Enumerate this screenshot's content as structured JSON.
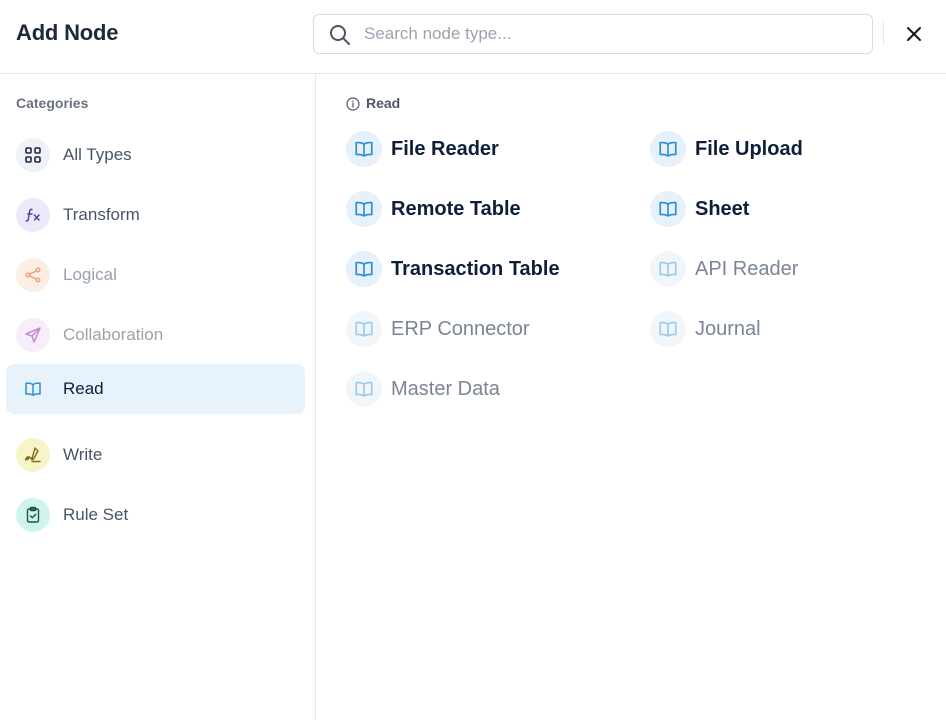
{
  "header": {
    "title": "Add Node",
    "search_placeholder": "Search node type...",
    "search_value": ""
  },
  "sidebar": {
    "heading": "Categories",
    "items": [
      {
        "label": "All Types",
        "icon": "grid-icon",
        "state": "normal"
      },
      {
        "label": "Transform",
        "icon": "function-icon",
        "state": "normal"
      },
      {
        "label": "Logical",
        "icon": "share-branch-icon",
        "state": "disabled"
      },
      {
        "label": "Collaboration",
        "icon": "send-icon",
        "state": "disabled"
      },
      {
        "label": "Read",
        "icon": "book-icon",
        "state": "active"
      },
      {
        "label": "Write",
        "icon": "signature-pen-icon",
        "state": "normal"
      },
      {
        "label": "Rule Set",
        "icon": "clipboard-check-icon",
        "state": "normal"
      }
    ]
  },
  "main": {
    "heading": "Read",
    "nodes": [
      {
        "label": "File Reader",
        "enabled": true
      },
      {
        "label": "File Upload",
        "enabled": true
      },
      {
        "label": "Remote Table",
        "enabled": true
      },
      {
        "label": "Sheet",
        "enabled": true
      },
      {
        "label": "Transaction Table",
        "enabled": true
      },
      {
        "label": "API Reader",
        "enabled": false
      },
      {
        "label": "ERP Connector",
        "enabled": false
      },
      {
        "label": "Journal",
        "enabled": false
      },
      {
        "label": "Master Data",
        "enabled": false
      }
    ]
  },
  "colors": {
    "accent": "#2b8fd6",
    "active_bg": "#e8f2fb",
    "text_dark": "#0f1f3a",
    "text_muted": "#7a8595",
    "border": "#e5e7eb"
  }
}
